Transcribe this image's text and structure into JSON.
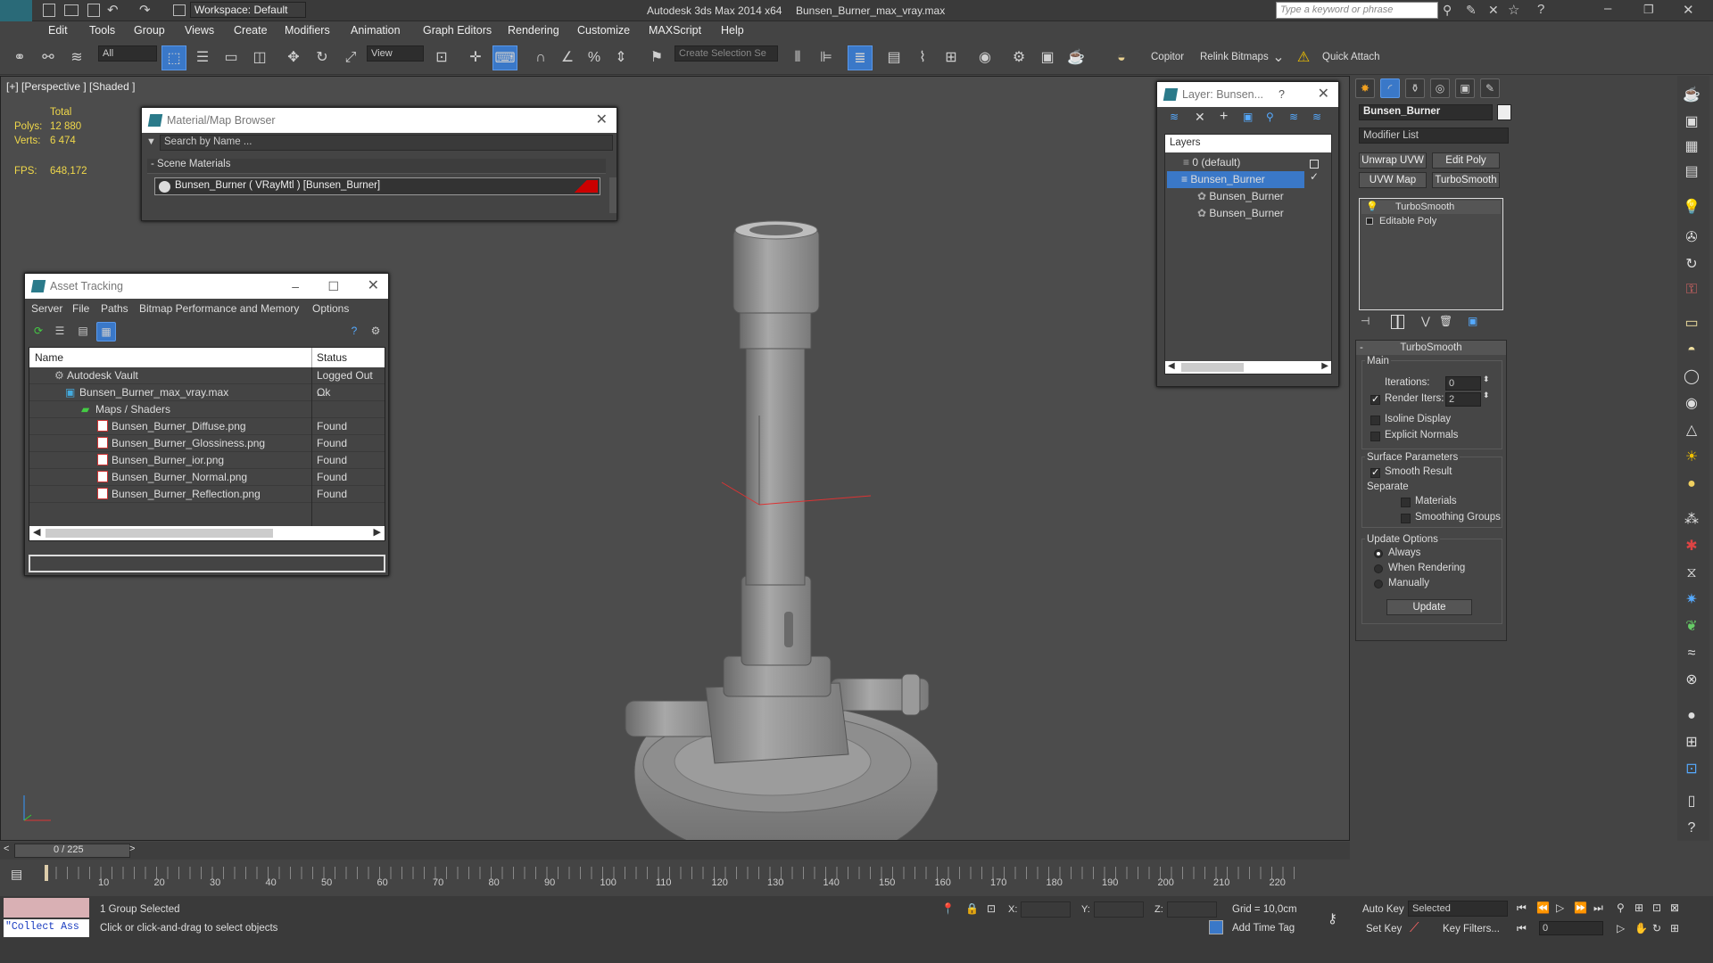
{
  "titlebar": {
    "workspace": "Workspace: Default",
    "app_title": "Autodesk 3ds Max  2014 x64",
    "file_name": "Bunsen_Burner_max_vray.max",
    "search_placeholder": "Type a keyword or phrase"
  },
  "menu": [
    "Edit",
    "Tools",
    "Group",
    "Views",
    "Create",
    "Modifiers",
    "Animation",
    "Graph Editors",
    "Rendering",
    "Customize",
    "MAXScript",
    "Help"
  ],
  "toolbar": {
    "filter_value": "All",
    "refcoord_value": "View",
    "named_selection_placeholder": "Create Selection Se",
    "copitor_label": "Copitor",
    "relink_label": "Relink Bitmaps",
    "quickattach_label": "Quick Attach"
  },
  "viewport": {
    "label": "[+] [Perspective ] [Shaded ]",
    "stats_header": "Total",
    "polys_label": "Polys:",
    "polys_value": "12 880",
    "verts_label": "Verts:",
    "verts_value": "6 474",
    "fps_label": "FPS:",
    "fps_value": "648,172"
  },
  "material_browser": {
    "title": "Material/Map Browser",
    "search_placeholder": "Search by Name ...",
    "section": "- Scene Materials",
    "material": "Bunsen_Burner  ( VRayMtl )  [Bunsen_Burner]"
  },
  "asset_tracking": {
    "title": "Asset Tracking",
    "menu": [
      "Server",
      "File",
      "Paths",
      "Bitmap Performance and Memory",
      "Options"
    ],
    "col_name": "Name",
    "col_status": "Status",
    "rows": [
      {
        "name": "Autodesk Vault",
        "status": "Logged Out ..."
      },
      {
        "name": "Bunsen_Burner_max_vray.max",
        "status": "Ok"
      },
      {
        "name": "Maps / Shaders",
        "status": ""
      },
      {
        "name": "Bunsen_Burner_Diffuse.png",
        "status": "Found"
      },
      {
        "name": "Bunsen_Burner_Glossiness.png",
        "status": "Found"
      },
      {
        "name": "Bunsen_Burner_ior.png",
        "status": "Found"
      },
      {
        "name": "Bunsen_Burner_Normal.png",
        "status": "Found"
      },
      {
        "name": "Bunsen_Burner_Reflection.png",
        "status": "Found"
      }
    ]
  },
  "layer_explorer": {
    "title": "Layer: Bunsen...",
    "help": "?",
    "header": "Layers",
    "items": [
      "0 (default)",
      "Bunsen_Burner",
      "Bunsen_Burner",
      "Bunsen_Burner"
    ]
  },
  "command_panel": {
    "object_name": "Bunsen_Burner",
    "modifier_list": "Modifier List",
    "btn_unwrap": "Unwrap UVW",
    "btn_editpoly": "Edit Poly",
    "btn_uvwmap": "UVW Map",
    "btn_turbosmooth": "TurboSmooth",
    "stack": [
      "TurboSmooth",
      "Editable Poly"
    ],
    "rollout_title": "TurboSmooth",
    "main_group": "Main",
    "iterations_label": "Iterations:",
    "iterations_value": "0",
    "render_iters_label": "Render Iters:",
    "render_iters_value": "2",
    "isoline": "Isoline Display",
    "explicit_normals": "Explicit Normals",
    "surface_group": "Surface Parameters",
    "smooth_result": "Smooth Result",
    "separate": "Separate",
    "materials": "Materials",
    "smoothing_groups": "Smoothing Groups",
    "update_group": "Update Options",
    "always": "Always",
    "when_rendering": "When Rendering",
    "manually": "Manually",
    "update_btn": "Update"
  },
  "timeline": {
    "frame": "0 / 225",
    "ticks": [
      "10",
      "20",
      "30",
      "40",
      "50",
      "60",
      "70",
      "80",
      "90",
      "100",
      "110",
      "120",
      "130",
      "140",
      "150",
      "160",
      "170",
      "180",
      "190",
      "200",
      "210",
      "220"
    ]
  },
  "status": {
    "maxscript": "\"Collect Ass",
    "selection": "1 Group Selected",
    "prompt": "Click or click-and-drag to select objects",
    "x_label": "X:",
    "y_label": "Y:",
    "z_label": "Z:",
    "grid": "Grid = 10,0cm",
    "add_time_tag": "Add Time Tag",
    "auto_key": "Auto Key",
    "set_key": "Set Key",
    "selected_value": "Selected",
    "key_filters": "Key Filters...",
    "frame_value": "0"
  }
}
